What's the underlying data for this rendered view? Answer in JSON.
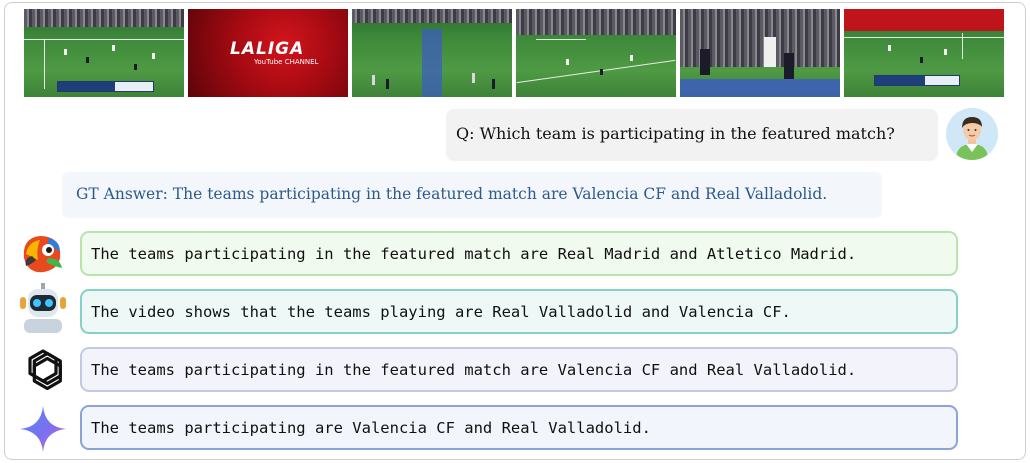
{
  "video_frames": {
    "frame2": {
      "logo_text": "LALIGA",
      "channel_text": "YouTube CHANNEL"
    }
  },
  "question": {
    "text": "Q: Which team is participating in the featured match?"
  },
  "ground_truth": {
    "text": "GT Answer: The teams participating in the featured match are Valencia CF and Real Valladolid."
  },
  "answers": [
    {
      "icon": "parrot-model-icon",
      "text": "The teams participating in the featured match are Real Madrid and Atletico Madrid.",
      "border_color": "#b7e3ad"
    },
    {
      "icon": "robot-model-icon",
      "text": "The video shows that the teams playing are Real Valladolid and Valencia CF.",
      "border_color": "#86d1c7"
    },
    {
      "icon": "openai-logo-icon",
      "text": "The teams participating in the featured match are Valencia CF and Real Valladolid.",
      "border_color": "#c4c8e6"
    },
    {
      "icon": "gemini-star-icon",
      "text": "The teams participating are Valencia CF and Real Valladolid.",
      "border_color": "#8aa3d8"
    }
  ]
}
